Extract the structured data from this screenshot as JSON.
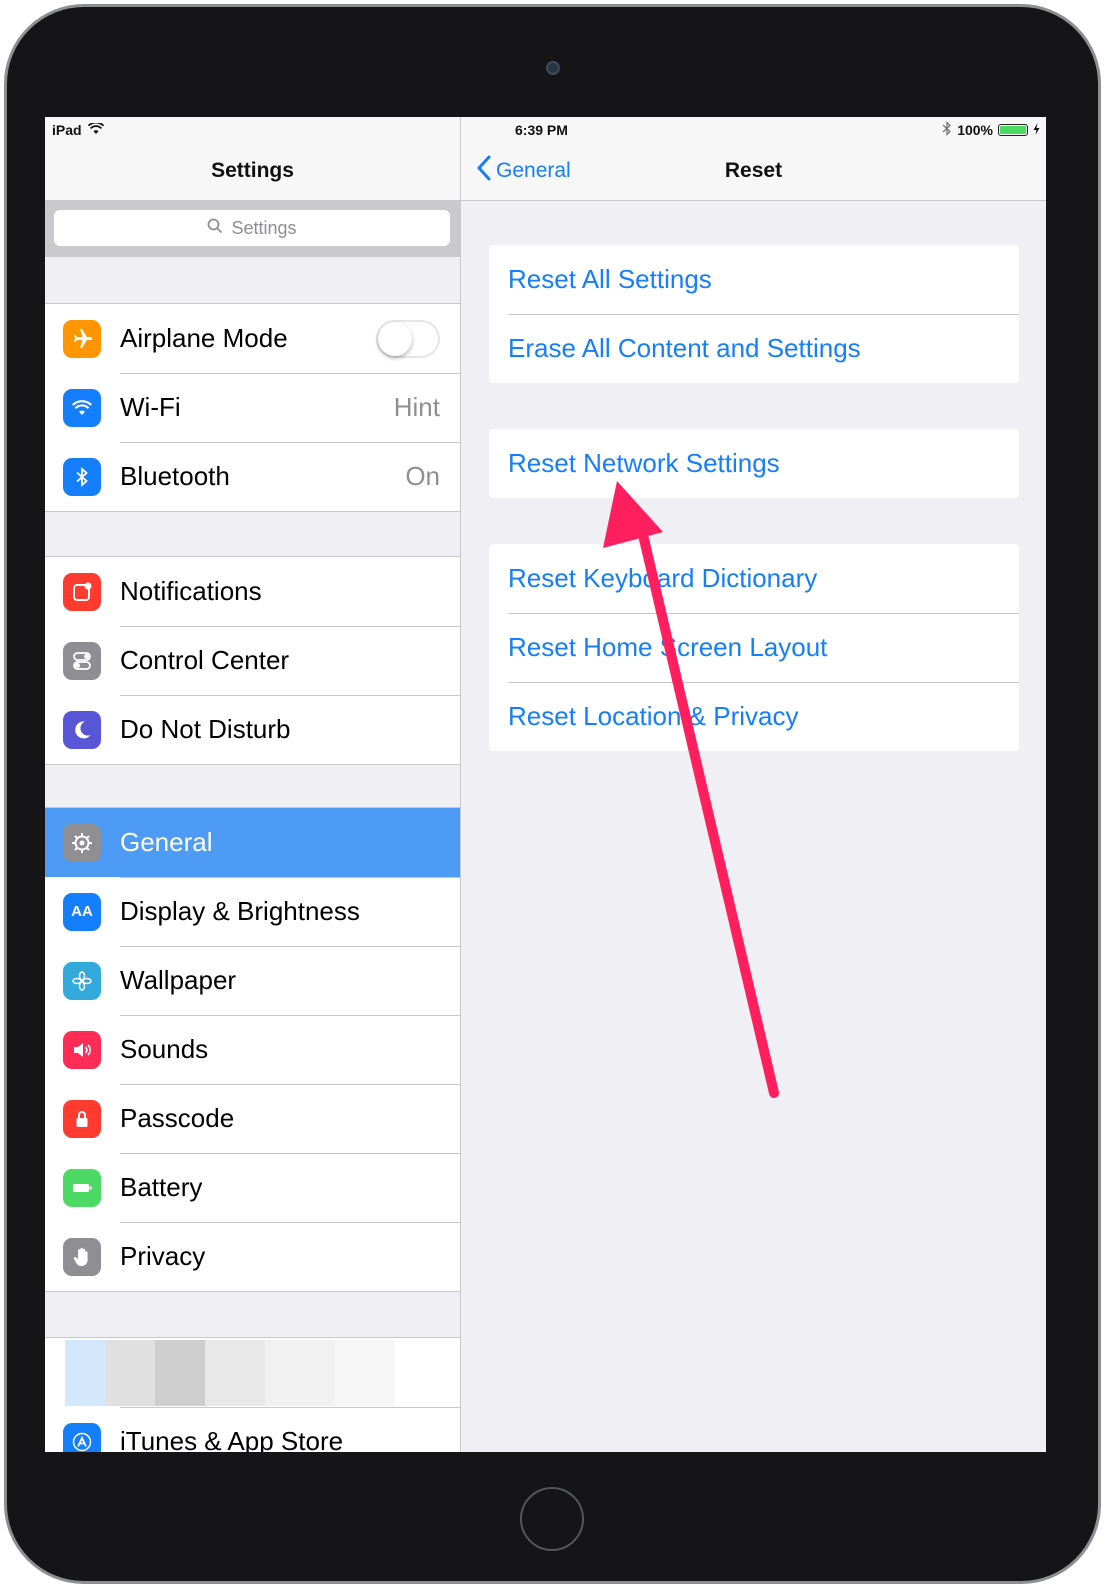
{
  "status_bar": {
    "device": "iPad",
    "time": "6:39 PM",
    "battery": "100%"
  },
  "master": {
    "title": "Settings",
    "search_placeholder": "Settings",
    "groups": [
      [
        {
          "label": "Airplane Mode",
          "icon": "airplane-icon",
          "color": "#ff9500",
          "toggle": false
        },
        {
          "label": "Wi-Fi",
          "value": "Hint",
          "icon": "wifi-icon",
          "color": "#157efb"
        },
        {
          "label": "Bluetooth",
          "value": "On",
          "icon": "bluetooth-icon",
          "color": "#157efb"
        }
      ],
      [
        {
          "label": "Notifications",
          "icon": "notifications-icon",
          "color": "#ff3b30"
        },
        {
          "label": "Control Center",
          "icon": "control-center-icon",
          "color": "#8e8e93"
        },
        {
          "label": "Do Not Disturb",
          "icon": "moon-icon",
          "color": "#5856d6"
        }
      ],
      [
        {
          "label": "General",
          "icon": "gear-icon",
          "color": "#8e8e93",
          "selected": true
        },
        {
          "label": "Display & Brightness",
          "icon": "display-brightness-icon",
          "color": "#157efb",
          "glyph": "AA"
        },
        {
          "label": "Wallpaper",
          "icon": "wallpaper-icon",
          "color": "#34aadc"
        },
        {
          "label": "Sounds",
          "icon": "speaker-icon",
          "color": "#ff2d55"
        },
        {
          "label": "Passcode",
          "icon": "lock-icon",
          "color": "#ff3b30"
        },
        {
          "label": "Battery",
          "icon": "battery-icon",
          "color": "#4cd964"
        },
        {
          "label": "Privacy",
          "icon": "hand-icon",
          "color": "#8e8e93"
        }
      ],
      [
        {
          "label": "iTunes & App Store",
          "icon": "app-store-icon",
          "color": "#157efb"
        }
      ]
    ]
  },
  "detail": {
    "back_label": "General",
    "title": "Reset",
    "groups": [
      [
        "Reset All Settings",
        "Erase All Content and Settings"
      ],
      [
        "Reset Network Settings"
      ],
      [
        "Reset Keyboard Dictionary",
        "Reset Home Screen Layout",
        "Reset Location & Privacy"
      ]
    ]
  },
  "annotation": {
    "color": "#ff1f5e"
  }
}
